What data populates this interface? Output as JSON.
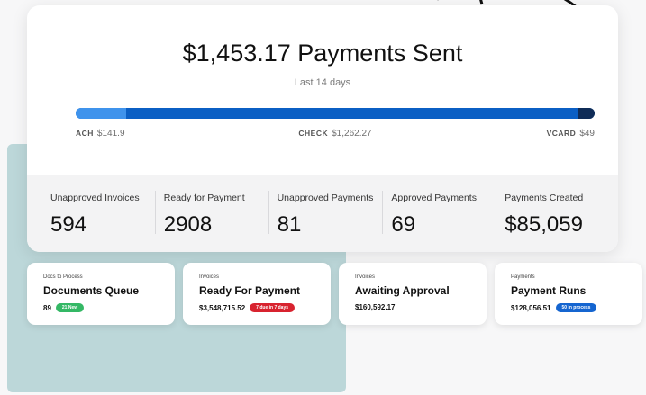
{
  "summary": {
    "headline": "$1,453.17 Payments Sent",
    "period": "Last 14 days"
  },
  "payment_split": {
    "segments": [
      {
        "key": "ACH",
        "amount": "$141.9",
        "value": 141.9,
        "color": "#3f93ec"
      },
      {
        "key": "CHECK",
        "amount": "$1,262.27",
        "value": 1262.27,
        "color": "#0b5fc4"
      },
      {
        "key": "VCARD",
        "amount": "$49",
        "value": 49,
        "color": "#0f2c57"
      }
    ]
  },
  "stats": [
    {
      "label": "Unapproved Invoices",
      "value": "594"
    },
    {
      "label": "Ready for Payment",
      "value": "2908"
    },
    {
      "label": "Unapproved Payments",
      "value": "81"
    },
    {
      "label": "Approved Payments",
      "value": "69"
    },
    {
      "label": "Payments Created",
      "value": "$85,059"
    }
  ],
  "cards": [
    {
      "category": "Docs to Process",
      "title": "Documents Queue",
      "amount": "89",
      "badge": "21 New",
      "badge_color": "#34b865"
    },
    {
      "category": "Invoices",
      "title": "Ready For Payment",
      "amount": "$3,548,715.52",
      "badge": "7 due in 7 days",
      "badge_color": "#d8232f"
    },
    {
      "category": "Invoices",
      "title": "Awaiting Approval",
      "amount": "$160,592.17",
      "badge": "",
      "badge_color": ""
    },
    {
      "category": "Payments",
      "title": "Payment Runs",
      "amount": "$128,056.51",
      "badge": "50 in process",
      "badge_color": "#1565d0"
    }
  ]
}
